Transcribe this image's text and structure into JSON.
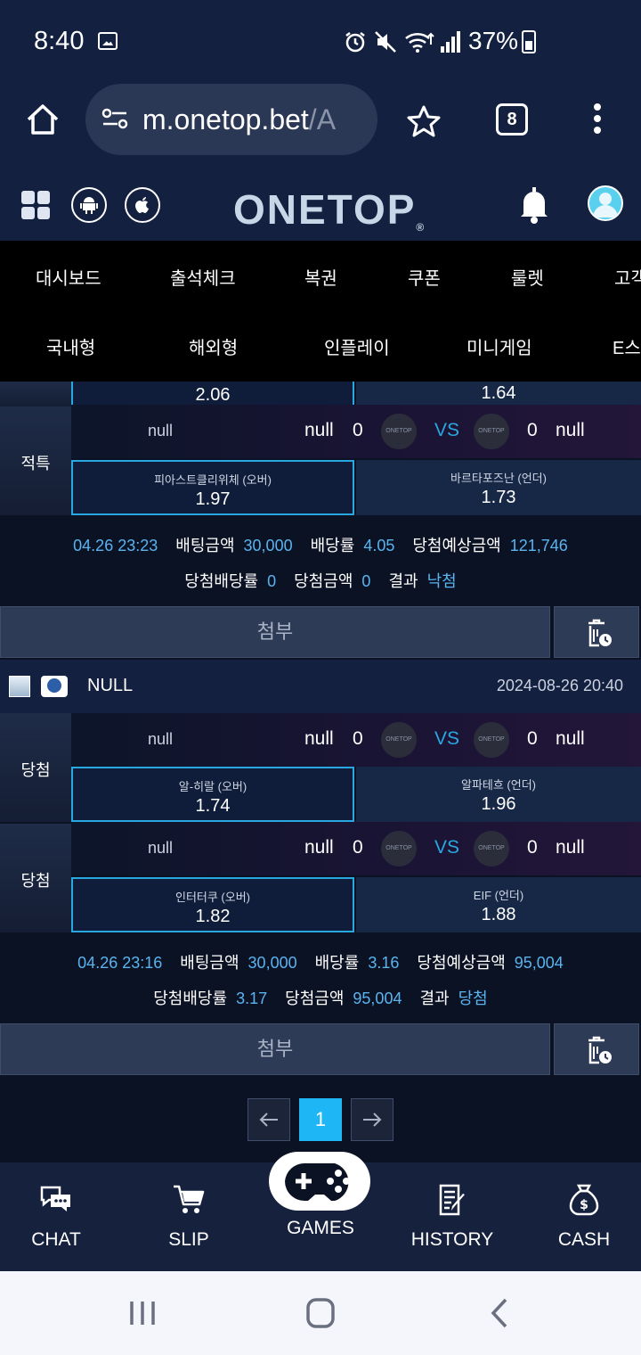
{
  "status": {
    "time": "8:40",
    "battery": "37%"
  },
  "browser": {
    "url_main": "m.onetop.bet",
    "url_rest": "/A",
    "tab_count": "8"
  },
  "site": {
    "logo": "ONETOP",
    "logo_mark": "®"
  },
  "menu1": [
    "대시보드",
    "출석체크",
    "복권",
    "쿠폰",
    "룰렛",
    "고객"
  ],
  "menu2": [
    "국내형",
    "해외형",
    "인플레이",
    "미니게임",
    "E스포"
  ],
  "partial_top": {
    "left_odd": "2.06",
    "right_odd": "1.64"
  },
  "ticket1": {
    "rows": [
      {
        "status": "적특",
        "home_name": "null",
        "away_name": "null",
        "home_score": "0",
        "away_score": "0",
        "vs": "VS",
        "team_right": "null",
        "left_label": "피아스트클리위체 (오버)",
        "left_odd": "1.97",
        "right_label": "바르타포즈난 (언더)",
        "right_odd": "1.73"
      }
    ],
    "summary": {
      "date": "04.26 23:23",
      "bet_label": "배팅금액",
      "bet": "30,000",
      "odds_label": "배당률",
      "odds": "4.05",
      "expected_label": "당첨예상금액",
      "expected": "121,746",
      "win_odds_label": "당첨배당률",
      "win_odds": "0",
      "win_amount_label": "당첨금액",
      "win_amount": "0",
      "result_label": "결과",
      "result": "낙첨"
    },
    "attach": "첨부"
  },
  "ticket2": {
    "title": "NULL",
    "datetime": "2024-08-26 20:40",
    "rows": [
      {
        "status": "당첨",
        "home_name": "null",
        "away_name": "null",
        "home_score": "0",
        "away_score": "0",
        "vs": "VS",
        "team_right": "null",
        "left_label": "알-히랄 (오버)",
        "left_odd": "1.74",
        "right_label": "알파테흐 (언더)",
        "right_odd": "1.96"
      },
      {
        "status": "당첨",
        "home_name": "null",
        "away_name": "null",
        "home_score": "0",
        "away_score": "0",
        "vs": "VS",
        "team_right": "null",
        "left_label": "인터터쿠 (오버)",
        "left_odd": "1.82",
        "right_label": "EIF (언더)",
        "right_odd": "1.88"
      }
    ],
    "summary": {
      "date": "04.26 23:16",
      "bet_label": "배팅금액",
      "bet": "30,000",
      "odds_label": "배당률",
      "odds": "3.16",
      "expected_label": "당첨예상금액",
      "expected": "95,004",
      "win_odds_label": "당첨배당률",
      "win_odds": "3.17",
      "win_amount_label": "당첨금액",
      "win_amount": "95,004",
      "result_label": "결과",
      "result": "당첨"
    },
    "attach": "첨부"
  },
  "logo_small": "ONETOP",
  "pager": {
    "current": "1"
  },
  "bottomnav": {
    "chat": "CHAT",
    "slip": "SLIP",
    "games": "GAMES",
    "history": "HISTORY",
    "cash": "CASH"
  },
  "colors": {
    "accent": "#29a7e1",
    "active_page": "#1fb6f5",
    "bg": "#0b1224",
    "header": "#13203f"
  }
}
